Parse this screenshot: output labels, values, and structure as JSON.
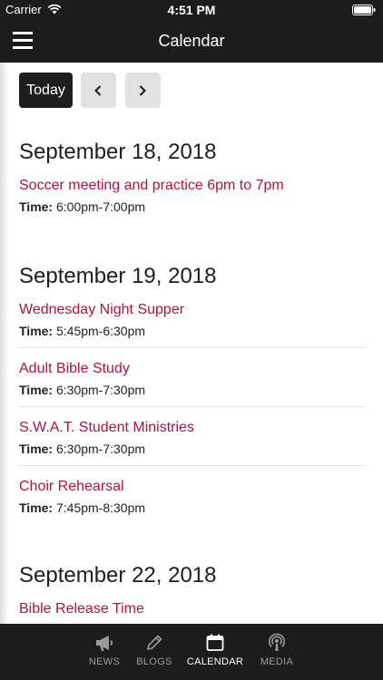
{
  "status_bar": {
    "carrier": "Carrier",
    "time": "4:51 PM"
  },
  "nav_bar": {
    "title": "Calendar"
  },
  "toolbar": {
    "today_label": "Today"
  },
  "time_label": "Time:",
  "days": [
    {
      "date": "September 18, 2018",
      "events": [
        {
          "title": "Soccer meeting and practice 6pm to 7pm",
          "time": "6:00pm-7:00pm"
        }
      ]
    },
    {
      "date": "September 19, 2018",
      "events": [
        {
          "title": "Wednesday Night Supper",
          "time": "5:45pm-6:30pm"
        },
        {
          "title": "Adult Bible Study",
          "time": "6:30pm-7:30pm"
        },
        {
          "title": "S.W.A.T. Student Ministries",
          "time": "6:30pm-7:30pm"
        },
        {
          "title": "Choir Rehearsal",
          "time": "7:45pm-8:30pm"
        }
      ]
    },
    {
      "date": "September 22, 2018",
      "events": [
        {
          "title": "Bible Release Time"
        }
      ]
    }
  ],
  "tabs": [
    {
      "label": "NEWS",
      "icon": "megaphone-icon",
      "active": false
    },
    {
      "label": "BLOGS",
      "icon": "pencil-icon",
      "active": false
    },
    {
      "label": "CALENDAR",
      "icon": "calendar-icon",
      "active": true
    },
    {
      "label": "MEDIA",
      "icon": "podcast-icon",
      "active": false
    }
  ],
  "colors": {
    "bar_background": "#1c1c1c",
    "event_title": "#b3123b",
    "tab_active": "#ffffff",
    "tab_inactive": "#9a9a9a"
  }
}
